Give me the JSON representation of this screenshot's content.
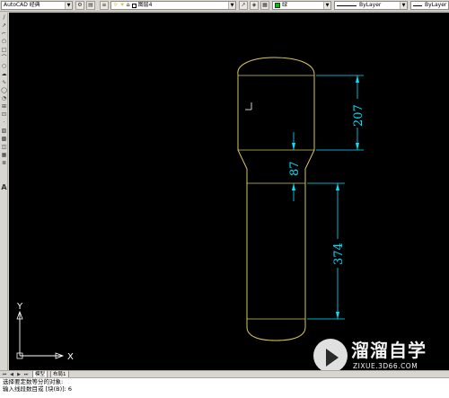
{
  "toolbar": {
    "workspace": "AutoCAD 经典",
    "layer_name": "图层4",
    "color_name": "绿",
    "linetype_1": "ByLayer",
    "linetype_2": "ByLayer",
    "lineweight": "ByLayer",
    "accent_green": "#00c000"
  },
  "tabs": {
    "model": "模型",
    "layout": "布局1"
  },
  "command_line": {
    "line1": "选择要定数等分的对象:",
    "line2": "输入线段数目或 [块(B)]: 6"
  },
  "drawing": {
    "dimensions": [
      "207",
      "87",
      "374"
    ],
    "ucs_x": "X",
    "ucs_y": "Y",
    "shape_color": "#d9c75a",
    "dim_color": "#00e5ff"
  },
  "watermark": {
    "title": "溜溜自学",
    "url": "ZIXUE.3D66.COM"
  }
}
